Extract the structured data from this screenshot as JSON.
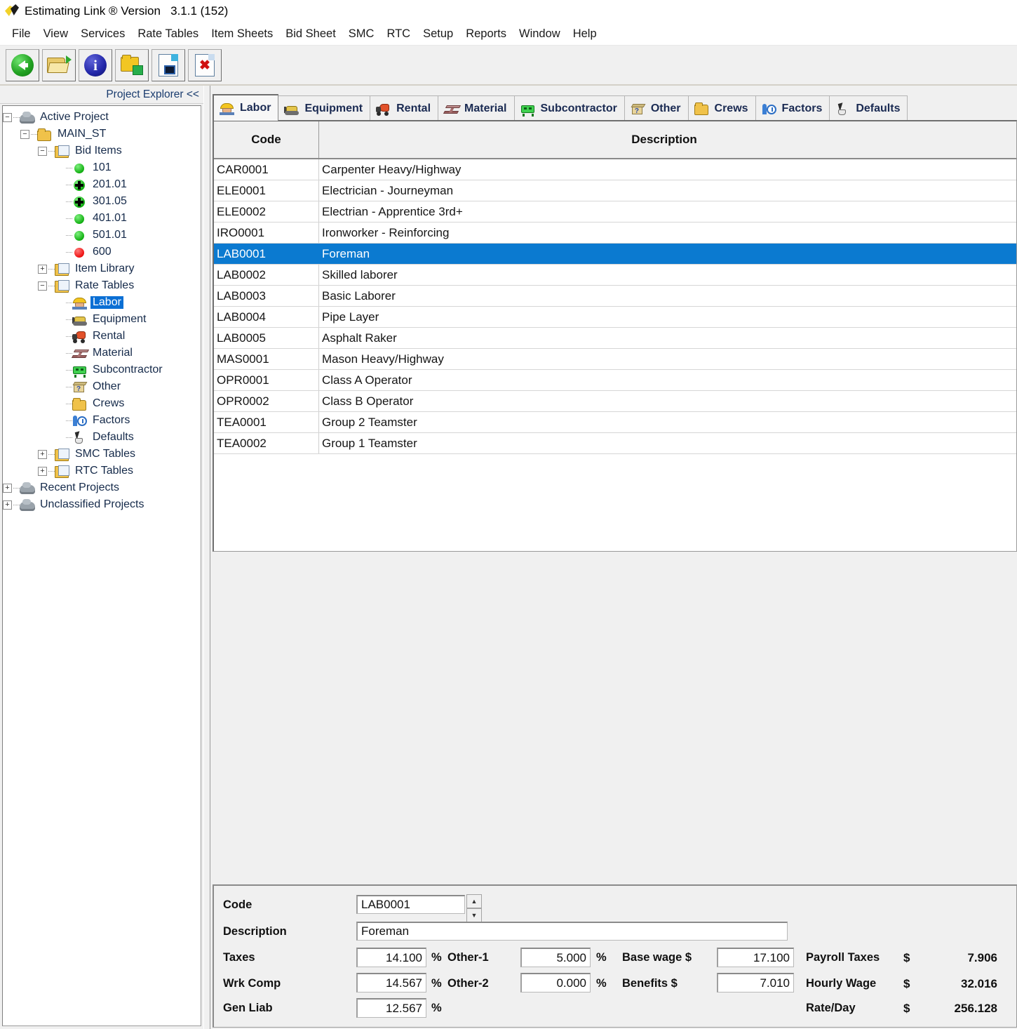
{
  "window": {
    "title": "Estimating Link ® Version   3.1.1 (152)",
    "logo_icon": "estimating-link-logo"
  },
  "menubar": {
    "items": [
      {
        "label": "File"
      },
      {
        "label": "View"
      },
      {
        "label": "Services"
      },
      {
        "label": "Rate Tables"
      },
      {
        "label": "Item Sheets"
      },
      {
        "label": "Bid Sheet"
      },
      {
        "label": "SMC"
      },
      {
        "label": "RTC"
      },
      {
        "label": "Setup"
      },
      {
        "label": "Reports"
      },
      {
        "label": "Window"
      },
      {
        "label": "Help"
      }
    ]
  },
  "toolbar": {
    "buttons": [
      {
        "icon": "back-arrow-icon"
      },
      {
        "icon": "open-folder-icon"
      },
      {
        "icon": "info-icon"
      },
      {
        "icon": "new-folder-icon"
      },
      {
        "icon": "save-document-icon"
      },
      {
        "icon": "delete-document-icon"
      }
    ]
  },
  "sidebar": {
    "header": "Project Explorer <<",
    "tree": [
      {
        "label": "Active Project",
        "icon": "cloud-icon",
        "indent": 0,
        "expander": "minus",
        "selected": false
      },
      {
        "label": "MAIN_ST",
        "icon": "folder-icon",
        "indent": 1,
        "expander": "minus",
        "selected": false
      },
      {
        "label": "Bid Items",
        "icon": "document-icon",
        "indent": 2,
        "expander": "minus",
        "selected": false
      },
      {
        "label": "101",
        "icon": "green-dot-icon",
        "indent": 3,
        "expander": "none",
        "selected": false
      },
      {
        "label": "201.01",
        "icon": "green-plus-icon",
        "indent": 3,
        "expander": "none",
        "selected": false
      },
      {
        "label": "301.05",
        "icon": "green-plus-icon",
        "indent": 3,
        "expander": "none",
        "selected": false
      },
      {
        "label": "401.01",
        "icon": "green-dot-icon",
        "indent": 3,
        "expander": "none",
        "selected": false
      },
      {
        "label": "501.01",
        "icon": "green-dot-icon",
        "indent": 3,
        "expander": "none",
        "selected": false
      },
      {
        "label": "600",
        "icon": "red-dot-icon",
        "indent": 3,
        "expander": "none",
        "selected": false
      },
      {
        "label": "Item Library",
        "icon": "document-icon",
        "indent": 2,
        "expander": "plus",
        "selected": false
      },
      {
        "label": "Rate Tables",
        "icon": "document-icon",
        "indent": 2,
        "expander": "minus",
        "selected": false
      },
      {
        "label": "Labor",
        "icon": "hardhat-icon",
        "indent": 3,
        "expander": "none",
        "selected": true
      },
      {
        "label": "Equipment",
        "icon": "dozer-icon",
        "indent": 3,
        "expander": "none",
        "selected": false
      },
      {
        "label": "Rental",
        "icon": "mixer-icon",
        "indent": 3,
        "expander": "none",
        "selected": false
      },
      {
        "label": "Material",
        "icon": "beam-icon",
        "indent": 3,
        "expander": "none",
        "selected": false
      },
      {
        "label": "Subcontractor",
        "icon": "subcontractor-icon",
        "indent": 3,
        "expander": "none",
        "selected": false
      },
      {
        "label": "Other",
        "icon": "box-icon",
        "indent": 3,
        "expander": "none",
        "selected": false
      },
      {
        "label": "Crews",
        "icon": "folder-icon",
        "indent": 3,
        "expander": "none",
        "selected": false
      },
      {
        "label": "Factors",
        "icon": "clock-icon",
        "indent": 3,
        "expander": "none",
        "selected": false
      },
      {
        "label": "Defaults",
        "icon": "cursor-icon",
        "indent": 3,
        "expander": "none",
        "selected": false
      },
      {
        "label": "SMC Tables",
        "icon": "document-icon",
        "indent": 2,
        "expander": "plus",
        "selected": false
      },
      {
        "label": "RTC Tables",
        "icon": "document-icon",
        "indent": 2,
        "expander": "plus",
        "selected": false
      },
      {
        "label": "Recent Projects",
        "icon": "cloud-icon",
        "indent": 0,
        "expander": "plus",
        "selected": false
      },
      {
        "label": "Unclassified Projects",
        "icon": "cloud-icon",
        "indent": 0,
        "expander": "plus",
        "selected": false
      }
    ]
  },
  "tabs": [
    {
      "label": "Labor",
      "icon": "hardhat-icon",
      "active": true
    },
    {
      "label": "Equipment",
      "icon": "dozer-icon",
      "active": false
    },
    {
      "label": "Rental",
      "icon": "mixer-icon",
      "active": false
    },
    {
      "label": "Material",
      "icon": "beam-icon",
      "active": false
    },
    {
      "label": "Subcontractor",
      "icon": "subcontractor-icon",
      "active": false
    },
    {
      "label": "Other",
      "icon": "box-icon",
      "active": false
    },
    {
      "label": "Crews",
      "icon": "folder-icon",
      "active": false
    },
    {
      "label": "Factors",
      "icon": "clock-icon",
      "active": false
    },
    {
      "label": "Defaults",
      "icon": "cursor-icon",
      "active": false
    }
  ],
  "grid": {
    "columns": [
      "Code",
      "Description"
    ],
    "selected_index": 4,
    "rows": [
      {
        "code": "CAR0001",
        "description": "Carpenter Heavy/Highway"
      },
      {
        "code": "ELE0001",
        "description": "Electrician - Journeyman"
      },
      {
        "code": "ELE0002",
        "description": "Electrian - Apprentice 3rd+"
      },
      {
        "code": "IRO0001",
        "description": "Ironworker - Reinforcing"
      },
      {
        "code": "LAB0001",
        "description": "Foreman"
      },
      {
        "code": "LAB0002",
        "description": "Skilled laborer"
      },
      {
        "code": "LAB0003",
        "description": "Basic Laborer"
      },
      {
        "code": "LAB0004",
        "description": "Pipe Layer"
      },
      {
        "code": "LAB0005",
        "description": "Asphalt Raker"
      },
      {
        "code": "MAS0001",
        "description": "Mason Heavy/Highway"
      },
      {
        "code": "OPR0001",
        "description": "Class A Operator"
      },
      {
        "code": "OPR0002",
        "description": "Class B Operator"
      },
      {
        "code": "TEA0001",
        "description": "Group 2 Teamster"
      },
      {
        "code": "TEA0002",
        "description": "Group 1 Teamster"
      }
    ]
  },
  "detail": {
    "code_label": "Code",
    "code_value": "LAB0001",
    "description_label": "Description",
    "description_value": "Foreman",
    "taxes_label": "Taxes",
    "taxes_value": "14.100",
    "taxes_unit": "%",
    "wrk_comp_label": "Wrk Comp",
    "wrk_comp_value": "14.567",
    "wrk_comp_unit": "%",
    "gen_liab_label": "Gen Liab",
    "gen_liab_value": "12.567",
    "gen_liab_unit": "%",
    "other1_label": "Other-1",
    "other1_value": "5.000",
    "other1_unit": "%",
    "other2_label": "Other-2",
    "other2_value": "0.000",
    "other2_unit": "%",
    "base_wage_label": "Base wage $",
    "base_wage_value": "17.100",
    "benefits_label": "Benefits $",
    "benefits_value": "7.010",
    "payroll_taxes_label": "Payroll Taxes",
    "payroll_taxes_currency": "$",
    "payroll_taxes_value": "7.906",
    "hourly_wage_label": "Hourly Wage",
    "hourly_wage_currency": "$",
    "hourly_wage_value": "32.016",
    "rate_day_label": "Rate/Day",
    "rate_day_currency": "$",
    "rate_day_value": "256.128"
  },
  "colors": {
    "selection": "#0b7ad0",
    "window_bg": "#f0f0f0",
    "grid_bg": "#ffffff"
  }
}
